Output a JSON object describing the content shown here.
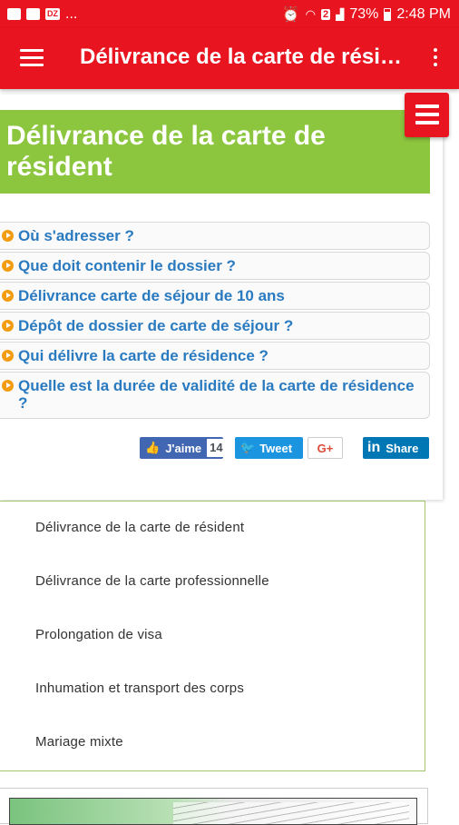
{
  "status_bar": {
    "notifications": [
      "image-icon",
      "message-icon",
      "dz-icon"
    ],
    "dz_label": "DZ",
    "more": "...",
    "icons": [
      "alarm-icon",
      "wifi-icon",
      "sim-icon",
      "signal-icon"
    ],
    "sim_label": "2",
    "battery": "73%",
    "time": "2:48 PM"
  },
  "app_bar": {
    "title": "Délivrance de la carte de résid…"
  },
  "page": {
    "title": "Délivrance de la carte de résident"
  },
  "questions": [
    "Où s'adresser ?",
    "Que doit contenir le dossier ?",
    "Délivrance carte de séjour de 10 ans",
    "Dépôt de dossier de carte de séjour ?",
    "Qui délivre la carte de résidence ?",
    "Quelle est la durée de validité de la carte de résidence ?"
  ],
  "share": {
    "facebook_label": "J'aime",
    "facebook_count": "14",
    "twitter_label": "Tweet",
    "google_label": "G+",
    "linkedin_label": "Share",
    "linkedin_logo": "in"
  },
  "related_links": [
    "Délivrance de la carte de résident",
    "Délivrance de la carte professionnelle",
    "Prolongation de visa",
    "Inhumation et transport des corps",
    "Mariage mixte"
  ],
  "colors": {
    "primary_red": "#e8141f",
    "title_green": "#8cc63f",
    "link_blue": "#2a7ac0",
    "bullet_orange": "#f39c12"
  }
}
